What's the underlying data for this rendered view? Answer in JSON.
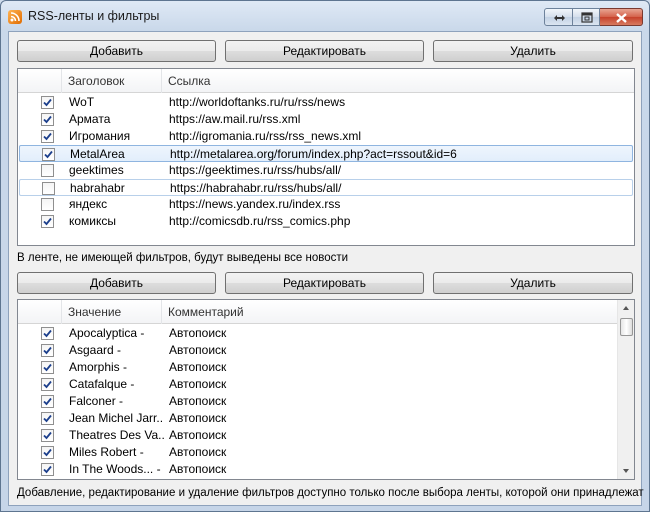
{
  "window": {
    "title": "RSS-ленты и фильтры",
    "controls": [
      "restore-icon",
      "maximize-icon",
      "close-icon"
    ]
  },
  "feeds_toolbar": {
    "add": "Добавить",
    "edit": "Редактировать",
    "delete": "Удалить"
  },
  "feeds": {
    "columns": [
      "Заголовок",
      "Ссылка"
    ],
    "rows": [
      {
        "checked": true,
        "title": "WoT",
        "url": "http://worldoftanks.ru/ru/rss/news"
      },
      {
        "checked": true,
        "title": "Армата",
        "url": "https://aw.mail.ru/rss.xml"
      },
      {
        "checked": true,
        "title": "Игромания",
        "url": "http://igromania.ru/rss/rss_news.xml"
      },
      {
        "checked": true,
        "title": "MetalArea",
        "url": "http://metalarea.org/forum/index.php?act=rssout&id=6",
        "selected": true
      },
      {
        "checked": false,
        "title": "geektimes",
        "url": "https://geektimes.ru/rss/hubs/all/"
      },
      {
        "checked": false,
        "title": "habrahabr",
        "url": "https://habrahabr.ru/rss/hubs/all/",
        "hover": true
      },
      {
        "checked": false,
        "title": "яндекс",
        "url": "https://news.yandex.ru/index.rss"
      },
      {
        "checked": true,
        "title": "комиксы",
        "url": "http://comicsdb.ru/rss_comics.php"
      }
    ]
  },
  "note_feeds": "В ленте, не имеющей фильтров, будут выведены все новости",
  "filters_toolbar": {
    "add": "Добавить",
    "edit": "Редактировать",
    "delete": "Удалить"
  },
  "filters": {
    "columns": [
      "Значение",
      "Комментарий"
    ],
    "rows": [
      {
        "checked": true,
        "value": "Apocalyptica -",
        "comment": "Автопоиск"
      },
      {
        "checked": true,
        "value": "Asgaard -",
        "comment": "Автопоиск"
      },
      {
        "checked": true,
        "value": "Amorphis -",
        "comment": "Автопоиск"
      },
      {
        "checked": true,
        "value": "Catafalque -",
        "comment": "Автопоиск"
      },
      {
        "checked": true,
        "value": "Falconer -",
        "comment": "Автопоиск"
      },
      {
        "checked": true,
        "value": "Jean Michel Jarr...",
        "comment": "Автопоиск"
      },
      {
        "checked": true,
        "value": "Theatres Des Va...",
        "comment": "Автопоиск"
      },
      {
        "checked": true,
        "value": "Miles Robert -",
        "comment": "Автопоиск"
      },
      {
        "checked": true,
        "value": "In The Woods... -",
        "comment": "Автопоиск"
      }
    ]
  },
  "note_filters": "Добавление, редактирование и удаление фильтров доступно только после выбора ленты, которой они принадлежат",
  "colors": {
    "selection_border": "#8fb5e0",
    "close_button": "#c6412b",
    "rss_icon": "#e06b00"
  }
}
